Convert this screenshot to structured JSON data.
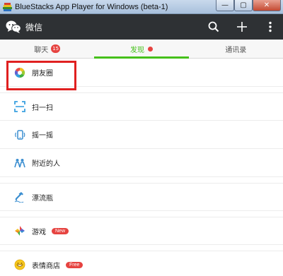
{
  "window": {
    "title": "BlueStacks App Player for Windows (beta-1)",
    "controls": [
      "—",
      "▢",
      "✕"
    ]
  },
  "actionbar": {
    "app_name": "微信",
    "icons": [
      "search-icon",
      "add-icon",
      "more-icon"
    ]
  },
  "tabs": [
    {
      "label": "聊天",
      "badge": "15",
      "active": false
    },
    {
      "label": "发现",
      "dot": true,
      "active": true
    },
    {
      "label": "通讯录",
      "active": false
    }
  ],
  "list": [
    {
      "label": "朋友圈",
      "icon": "moments-icon"
    },
    {
      "label": "扫一扫",
      "icon": "scan-icon"
    },
    {
      "label": "摇一摇",
      "icon": "shake-icon"
    },
    {
      "label": "附近的人",
      "icon": "nearby-people-icon"
    },
    {
      "label": "漂流瓶",
      "icon": "drift-bottle-icon"
    },
    {
      "label": "游戏",
      "icon": "games-icon",
      "pill": "New"
    },
    {
      "label": "表情商店",
      "icon": "sticker-store-icon",
      "pill": "Free"
    }
  ],
  "colors": {
    "actionbar_bg": "#2e3134",
    "accent_green": "#45c01a",
    "badge_red": "#e64340",
    "highlight_red": "#e02020"
  }
}
